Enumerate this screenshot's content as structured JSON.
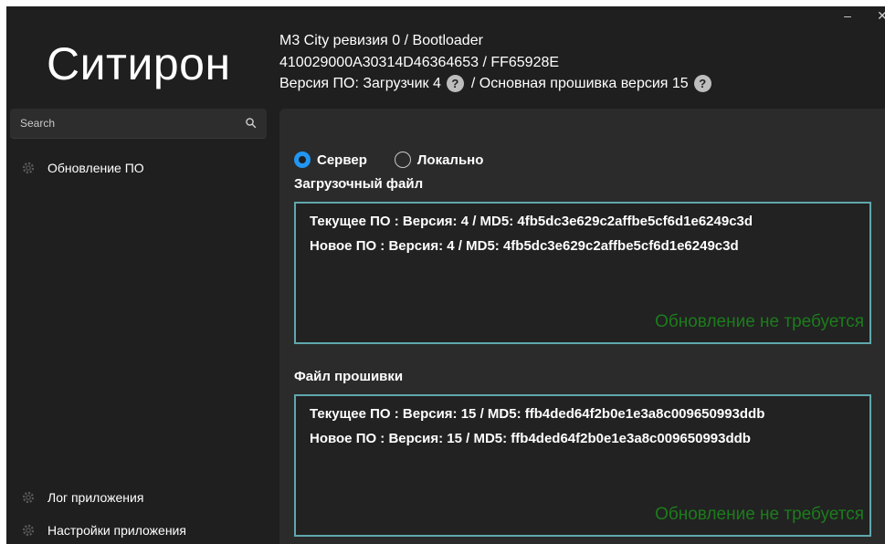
{
  "app": {
    "title": "Ситирон"
  },
  "window_controls": {
    "minimize": "–",
    "close": "✕"
  },
  "search": {
    "placeholder": "Search"
  },
  "sidebar": {
    "items": [
      {
        "label": "Обновление ПО",
        "icon": "gear-icon"
      },
      {
        "label": "Лог приложения",
        "icon": "gear-icon"
      },
      {
        "label": "Настройки приложения",
        "icon": "gear-icon"
      }
    ]
  },
  "header": {
    "line1": "M3 City ревизия 0 / Bootloader",
    "line2": "410029000A30314D46364653 / FF65928E",
    "line3_part1": "Версия ПО: Загрузчик 4",
    "line3_part2": "/ Основная прошивка версия 15",
    "help_glyph": "?"
  },
  "source": {
    "options": [
      {
        "label": "Сервер",
        "selected": true
      },
      {
        "label": "Локально",
        "selected": false
      }
    ],
    "accent_color": "#2196f3"
  },
  "bootloader": {
    "title": "Загрузочный файл",
    "current": "Текущее ПО : Версия: 4 / MD5: 4fb5dc3e629c2affbe5cf6d1e6249c3d",
    "new": "Новое ПО : Версия: 4 / MD5: 4fb5dc3e629c2affbe5cf6d1e6249c3d",
    "status": "Обновление не требуется",
    "status_color": "#1c7c1c"
  },
  "firmware": {
    "title": "Файл прошивки",
    "current": "Текущее ПО : Версия: 15 / MD5: ffb4ded64f2b0e1e3a8c009650993ddb",
    "new": "Новое ПО : Версия: 15 / MD5: ffb4ded64f2b0e1e3a8c009650993ddb",
    "status": "Обновление не требуется",
    "status_color": "#1c7c1c"
  }
}
